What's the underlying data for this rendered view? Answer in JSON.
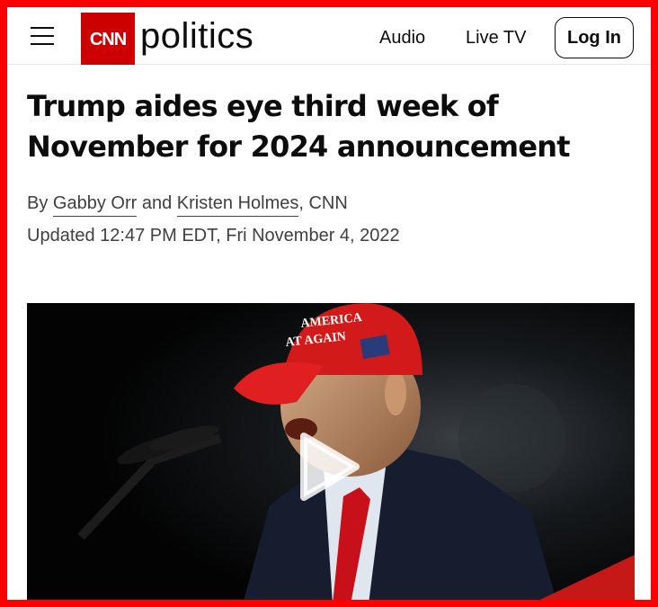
{
  "header": {
    "brand_logo_text": "CNN",
    "section_name": "politics",
    "nav": [
      {
        "label": "Audio"
      },
      {
        "label": "Live TV"
      }
    ],
    "login_label": "Log In",
    "icons": {
      "menu": "hamburger-menu-icon"
    }
  },
  "article": {
    "headline": "Trump aides eye third week of November for 2024 announcement",
    "byline": {
      "prefix": "By",
      "author1": "Gabby Orr",
      "joiner": "and",
      "author2": "Kristen Holmes",
      "suffix": ", CNN"
    },
    "timestamp": "Updated 12:47 PM EDT, Fri November 4, 2022",
    "video": {
      "hat_text_line1": "AMERICA",
      "hat_text_line2": "AT AGAIN",
      "icon": "play-icon"
    }
  },
  "colors": {
    "brand_red": "#cc0000",
    "frame_red": "#ff0000",
    "text": "#0c0c0c",
    "meta_text": "#404040"
  }
}
